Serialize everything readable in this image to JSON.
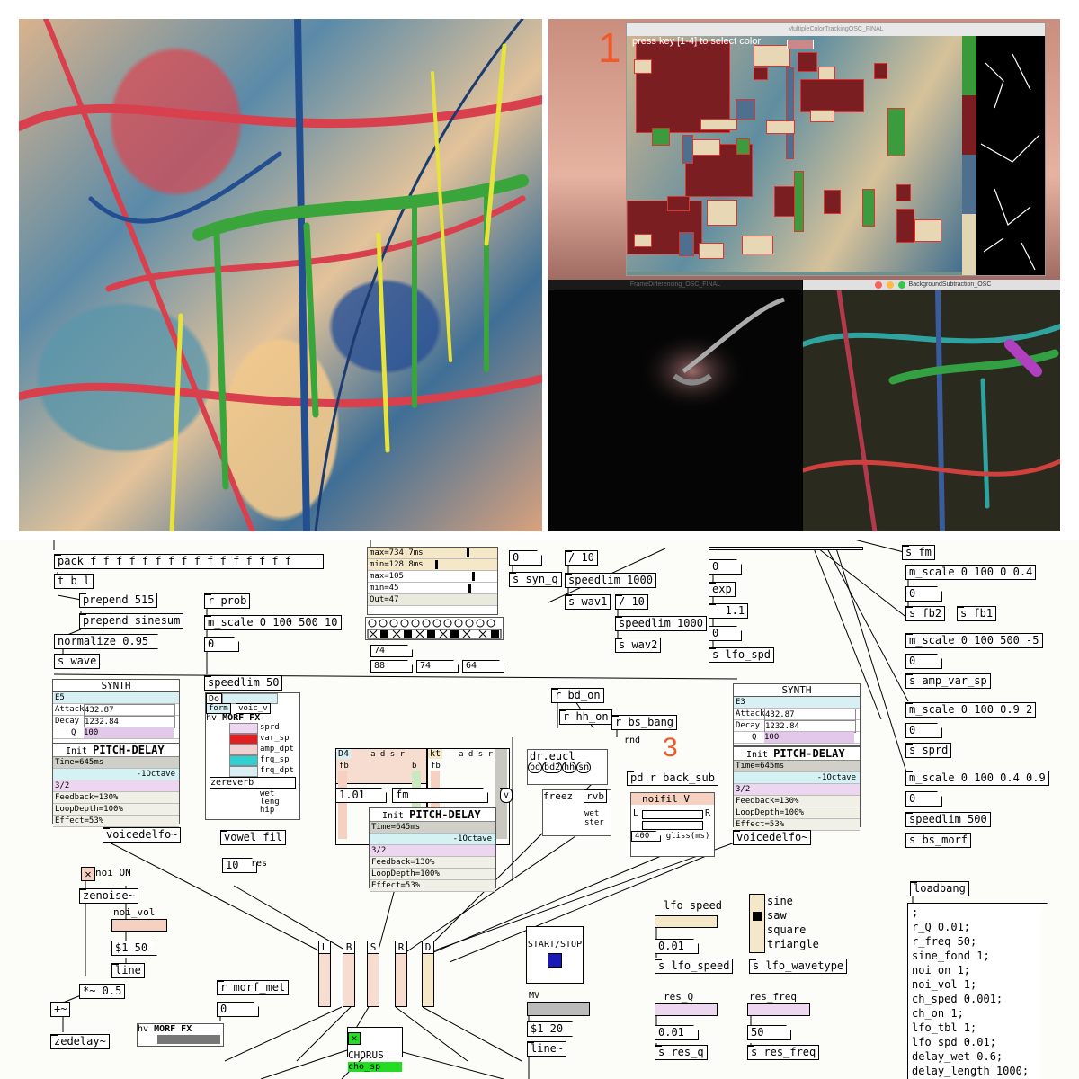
{
  "vision": {
    "prompt": "press key [1-4] to select color",
    "step_one": "1",
    "window_titles": {
      "color_tracking": "MultipleColorTrackingOSC_FINAL",
      "frame_diff": "FrameDifferencing_OSC_FINAL",
      "bg_sub": "BackgroundSubtraction_OSC"
    }
  },
  "patch": {
    "step_three": "3",
    "pack": "pack f f f f f f f f f f f f f f f f",
    "tbl": "t b l",
    "prepend515": "prepend 515",
    "prependsine": "prepend sinesum",
    "normalize": "normalize 0.95",
    "swave": "s wave",
    "rprob": "r prob",
    "mscale_prob": "m_scale 0 100 500 10",
    "zero": "0",
    "speedlim50": "speedlim 50",
    "metro": {
      "max1": "max=734.7ms",
      "min1": "min=128.8ms",
      "max2": "max=105",
      "min2": "min=45",
      "out": "Out=47"
    },
    "n74a": "74",
    "n88": "88",
    "n74b": "74",
    "n64": "64",
    "ssynq": "s syn_q",
    "div10a": "/ 10",
    "speedlim1000a": "speedlim 1000",
    "swav1": "s wav1",
    "div10b": "/ 10",
    "speedlim1000b": "speedlim 1000",
    "swav2": "s wav2",
    "exp": "exp",
    "minus11": "- 1.1",
    "slfospd": "s lfo_spd",
    "mscale_fb": "m_scale 0 100 0 0.4",
    "sfb2": "s fb2",
    "sfb1": "s fb1",
    "mscale_amp": "m_scale 0 100 500 -5",
    "sampvar": "s amp_var_sp",
    "mscale_sprd": "m_scale 0 100 0.9 2",
    "ssprd": "s sprd",
    "mscale_bs": "m_scale 0 100 0.4 0.9",
    "speedlim500": "speedlim 500",
    "sbsmorf": "s bs_morf",
    "synth_left": {
      "title": "SYNTH",
      "note": "E5",
      "attack": "Attack",
      "attack_v": "432.87",
      "decay": "Decay",
      "decay_v": "1232.84",
      "q": "Q",
      "q_v": "100"
    },
    "synth_right": {
      "title": "SYNTH",
      "note": "E3",
      "attack": "Attack",
      "attack_v": "432.87",
      "decay": "Decay",
      "decay_v": "1232.84",
      "q": "Q",
      "q_v": "100"
    },
    "pitch_delay": {
      "init": "Init",
      "title": "PITCH-DELAY",
      "time": "Time=645ms",
      "octave": "-1Octave",
      "ratio": "3/2",
      "feedback": "Feedback=130%",
      "loop": "LoopDepth=100%",
      "effect": "Effect=53%"
    },
    "voicedelfo": "voicedelfo~",
    "morf": {
      "do": "Do",
      "form": "form",
      "voic": "voic_v",
      "hv": "hv",
      "title": "MORF FX",
      "sprd": "sprd",
      "varsp": "var_sp",
      "ampdpt": "amp_dpt",
      "frqsp": "frq_sp",
      "frqdpt": "frq_dpt",
      "zereverb": "zereverb",
      "wet": "wet",
      "leng": "leng",
      "hip": "hip"
    },
    "vowel": "vowel fil",
    "n10": "10",
    "res": "res",
    "seq1": {
      "label": "D4",
      "letters": "a d s r",
      "b": "b",
      "fb": "fb"
    },
    "seq2": {
      "label": "kt",
      "letters": "a d s r",
      "fb": "fb"
    },
    "val101": "1.01",
    "fm": "fm",
    "v": "v",
    "rbdon": "r bd_on",
    "rhhon": "r hh_on",
    "rbsbang": "r bs_bang",
    "rnd": "rnd",
    "dreucl": "dr.eucl",
    "bd": "bd",
    "bd2": "bd2",
    "hh": "hh",
    "sn": "sn",
    "freez": "freez",
    "rvb": "rvb",
    "wetster": "wet ster",
    "pdback": "pd r back_sub",
    "noifil": "noifil V",
    "L": "L",
    "R": "R",
    "n400": "400",
    "gliss": "gliss(ms)",
    "noion": "noi_ON",
    "zenoise": "zenoise~",
    "noivol": "noi_vol",
    "dollar150": "$1 50",
    "line": "line",
    "times05": "*~ 0.5",
    "plus": "+~",
    "zedelay": "zedelay~",
    "hv2": "hv",
    "morf2": "MORF FX",
    "rmorfmet": "r morf_met",
    "chorus": "CHORUS",
    "chosp": "cho_sp",
    "mixer": [
      "L",
      "B",
      "S",
      "R",
      "D"
    ],
    "startstop": "START/STOP",
    "mv": "MV",
    "dollar120": "$1 20",
    "linetilde": "line~",
    "lfospeed": "lfo speed",
    "n001a": "0.01",
    "slfospeed": "s lfo_speed",
    "waves": [
      "sine",
      "saw",
      "square",
      "triangle"
    ],
    "slfowave": "s lfo_wavetype",
    "resq": "res_Q",
    "n001b": "0.01",
    "sresq": "s res_q",
    "resfreq": "res_freq",
    "n50": "50",
    "sresfreq": "s res_freq",
    "loadbang": "loadbang",
    "loadmsg": [
      ";",
      "r_Q 0.01;",
      "r_freq 50;",
      "sine_fond 1;",
      "noi_on 1;",
      "noi_vol 1;",
      "ch_sped 0.001;",
      "ch_on 1;",
      "lfo_tbl 1;",
      "lfo_spd 0.01;",
      "delay_wet 0.6;",
      "delay_length 1000;"
    ],
    "top_fm": "s fm"
  }
}
